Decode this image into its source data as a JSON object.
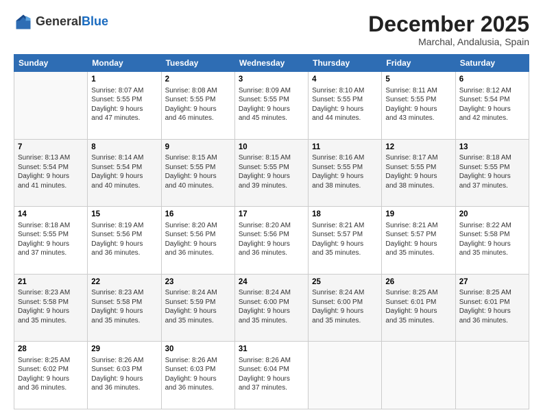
{
  "header": {
    "logo_general": "General",
    "logo_blue": "Blue",
    "month_title": "December 2025",
    "location": "Marchal, Andalusia, Spain"
  },
  "days_of_week": [
    "Sunday",
    "Monday",
    "Tuesday",
    "Wednesday",
    "Thursday",
    "Friday",
    "Saturday"
  ],
  "weeks": [
    [
      {
        "day": "",
        "info": ""
      },
      {
        "day": "1",
        "info": "Sunrise: 8:07 AM\nSunset: 5:55 PM\nDaylight: 9 hours\nand 47 minutes."
      },
      {
        "day": "2",
        "info": "Sunrise: 8:08 AM\nSunset: 5:55 PM\nDaylight: 9 hours\nand 46 minutes."
      },
      {
        "day": "3",
        "info": "Sunrise: 8:09 AM\nSunset: 5:55 PM\nDaylight: 9 hours\nand 45 minutes."
      },
      {
        "day": "4",
        "info": "Sunrise: 8:10 AM\nSunset: 5:55 PM\nDaylight: 9 hours\nand 44 minutes."
      },
      {
        "day": "5",
        "info": "Sunrise: 8:11 AM\nSunset: 5:55 PM\nDaylight: 9 hours\nand 43 minutes."
      },
      {
        "day": "6",
        "info": "Sunrise: 8:12 AM\nSunset: 5:54 PM\nDaylight: 9 hours\nand 42 minutes."
      }
    ],
    [
      {
        "day": "7",
        "info": "Sunrise: 8:13 AM\nSunset: 5:54 PM\nDaylight: 9 hours\nand 41 minutes."
      },
      {
        "day": "8",
        "info": "Sunrise: 8:14 AM\nSunset: 5:54 PM\nDaylight: 9 hours\nand 40 minutes."
      },
      {
        "day": "9",
        "info": "Sunrise: 8:15 AM\nSunset: 5:55 PM\nDaylight: 9 hours\nand 40 minutes."
      },
      {
        "day": "10",
        "info": "Sunrise: 8:15 AM\nSunset: 5:55 PM\nDaylight: 9 hours\nand 39 minutes."
      },
      {
        "day": "11",
        "info": "Sunrise: 8:16 AM\nSunset: 5:55 PM\nDaylight: 9 hours\nand 38 minutes."
      },
      {
        "day": "12",
        "info": "Sunrise: 8:17 AM\nSunset: 5:55 PM\nDaylight: 9 hours\nand 38 minutes."
      },
      {
        "day": "13",
        "info": "Sunrise: 8:18 AM\nSunset: 5:55 PM\nDaylight: 9 hours\nand 37 minutes."
      }
    ],
    [
      {
        "day": "14",
        "info": "Sunrise: 8:18 AM\nSunset: 5:55 PM\nDaylight: 9 hours\nand 37 minutes."
      },
      {
        "day": "15",
        "info": "Sunrise: 8:19 AM\nSunset: 5:56 PM\nDaylight: 9 hours\nand 36 minutes."
      },
      {
        "day": "16",
        "info": "Sunrise: 8:20 AM\nSunset: 5:56 PM\nDaylight: 9 hours\nand 36 minutes."
      },
      {
        "day": "17",
        "info": "Sunrise: 8:20 AM\nSunset: 5:56 PM\nDaylight: 9 hours\nand 36 minutes."
      },
      {
        "day": "18",
        "info": "Sunrise: 8:21 AM\nSunset: 5:57 PM\nDaylight: 9 hours\nand 35 minutes."
      },
      {
        "day": "19",
        "info": "Sunrise: 8:21 AM\nSunset: 5:57 PM\nDaylight: 9 hours\nand 35 minutes."
      },
      {
        "day": "20",
        "info": "Sunrise: 8:22 AM\nSunset: 5:58 PM\nDaylight: 9 hours\nand 35 minutes."
      }
    ],
    [
      {
        "day": "21",
        "info": "Sunrise: 8:23 AM\nSunset: 5:58 PM\nDaylight: 9 hours\nand 35 minutes."
      },
      {
        "day": "22",
        "info": "Sunrise: 8:23 AM\nSunset: 5:58 PM\nDaylight: 9 hours\nand 35 minutes."
      },
      {
        "day": "23",
        "info": "Sunrise: 8:24 AM\nSunset: 5:59 PM\nDaylight: 9 hours\nand 35 minutes."
      },
      {
        "day": "24",
        "info": "Sunrise: 8:24 AM\nSunset: 6:00 PM\nDaylight: 9 hours\nand 35 minutes."
      },
      {
        "day": "25",
        "info": "Sunrise: 8:24 AM\nSunset: 6:00 PM\nDaylight: 9 hours\nand 35 minutes."
      },
      {
        "day": "26",
        "info": "Sunrise: 8:25 AM\nSunset: 6:01 PM\nDaylight: 9 hours\nand 35 minutes."
      },
      {
        "day": "27",
        "info": "Sunrise: 8:25 AM\nSunset: 6:01 PM\nDaylight: 9 hours\nand 36 minutes."
      }
    ],
    [
      {
        "day": "28",
        "info": "Sunrise: 8:25 AM\nSunset: 6:02 PM\nDaylight: 9 hours\nand 36 minutes."
      },
      {
        "day": "29",
        "info": "Sunrise: 8:26 AM\nSunset: 6:03 PM\nDaylight: 9 hours\nand 36 minutes."
      },
      {
        "day": "30",
        "info": "Sunrise: 8:26 AM\nSunset: 6:03 PM\nDaylight: 9 hours\nand 36 minutes."
      },
      {
        "day": "31",
        "info": "Sunrise: 8:26 AM\nSunset: 6:04 PM\nDaylight: 9 hours\nand 37 minutes."
      },
      {
        "day": "",
        "info": ""
      },
      {
        "day": "",
        "info": ""
      },
      {
        "day": "",
        "info": ""
      }
    ]
  ]
}
